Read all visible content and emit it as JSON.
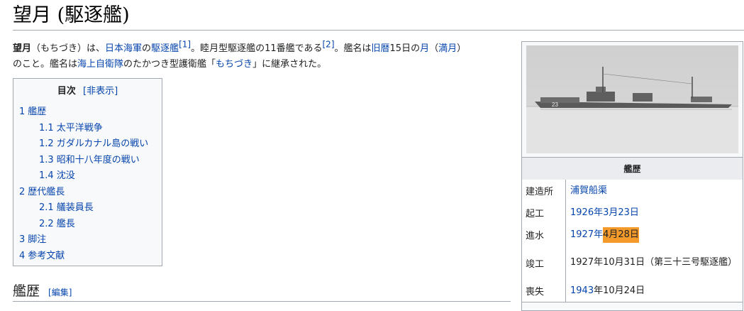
{
  "page": {
    "title": "望月 (駆逐艦)"
  },
  "lead": {
    "bold": "望月",
    "t1": "（もちづき）は、",
    "l1": "日本海軍",
    "t2": "の",
    "l2": "駆逐艦",
    "ref1": "[1]",
    "t3": "。睦月型駆逐艦の11番艦である",
    "ref2": "[2]",
    "t4": "。艦名は",
    "l3": "旧暦",
    "t5": "15日の",
    "l4": "月",
    "t6": "（",
    "l5": "満月",
    "t7": "）",
    "line2_a": "のこと。艦名は",
    "l6": "海上自衛隊",
    "line2_b": "のたかつき型護衛艦「",
    "l7": "もちづき",
    "line2_c": "」に継承された。"
  },
  "toc": {
    "heading": "目次",
    "toggle": "[非表示]",
    "items": [
      {
        "num": "1",
        "label": "艦歴"
      },
      {
        "num": "1.1",
        "label": "太平洋戦争"
      },
      {
        "num": "1.2",
        "label": "ガダルカナル島の戦い"
      },
      {
        "num": "1.3",
        "label": "昭和十八年度の戦い"
      },
      {
        "num": "1.4",
        "label": "沈没"
      },
      {
        "num": "2",
        "label": "歴代艦長"
      },
      {
        "num": "2.1",
        "label": "艤装員長"
      },
      {
        "num": "2.2",
        "label": "艦長"
      },
      {
        "num": "3",
        "label": "脚注"
      },
      {
        "num": "4",
        "label": "参考文献"
      }
    ]
  },
  "section": {
    "heading": "艦歴",
    "edit": "[編集]"
  },
  "infobox": {
    "header": "艦歴",
    "rows": [
      {
        "label": "建造所",
        "v1": "浦賀船渠"
      },
      {
        "label": "起工",
        "v1": "1926年3月23日"
      },
      {
        "label": "進水",
        "v1": "1927年",
        "v2": "4月28日"
      },
      {
        "label": "竣工",
        "v1": "1927年10月31日（第三十三号駆逐艦）"
      },
      {
        "label": "喪失",
        "v1": "1943",
        "v2": "年10月24日"
      }
    ]
  },
  "colors": {
    "link": "#0645ad",
    "highlight": "#f39a2b",
    "border": "#a2a9b1"
  }
}
